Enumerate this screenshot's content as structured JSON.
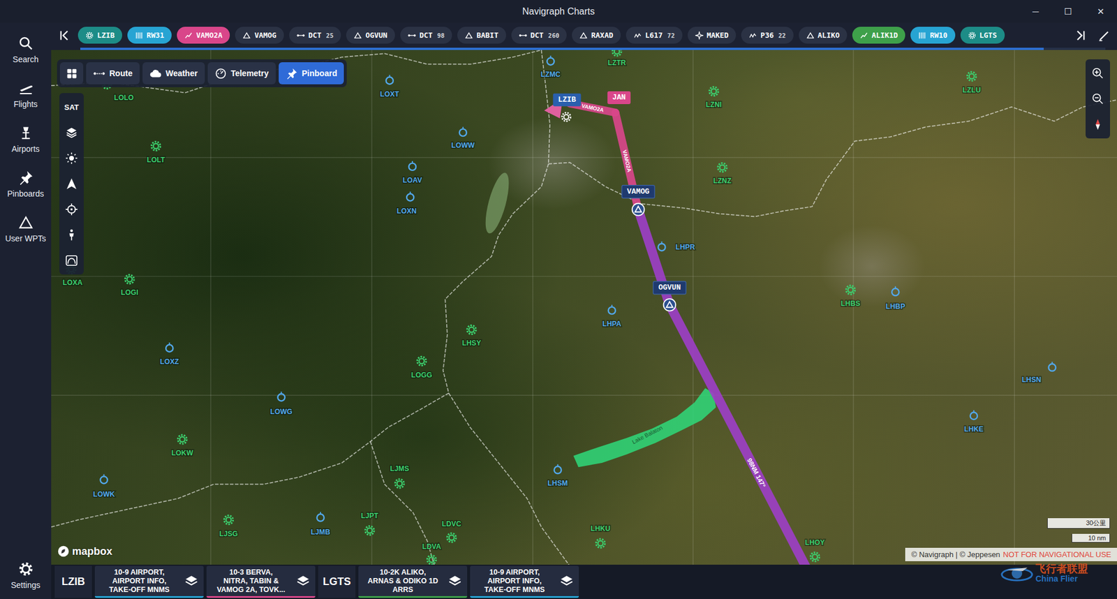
{
  "window": {
    "title": "Navigraph Charts",
    "controls": [
      "─",
      "☐",
      "✕"
    ]
  },
  "sidebar": {
    "items": [
      {
        "label": "Search",
        "selected": false
      },
      {
        "label": "Flights",
        "selected": false
      },
      {
        "label": "Airports",
        "selected": false
      },
      {
        "label": "Pinboards",
        "selected": false
      },
      {
        "label": "User WPTs",
        "selected": false
      }
    ],
    "settings": "Settings"
  },
  "route_strip": {
    "chips": [
      {
        "label": "LZIB",
        "kind": "airport",
        "color": "#1d8c87"
      },
      {
        "label": "RW31",
        "kind": "runway",
        "color": "#27a4d3"
      },
      {
        "label": "VAMO2A",
        "kind": "sid",
        "color": "#d9468a"
      },
      {
        "label": "VAMOG",
        "kind": "waypoint",
        "color": "#2b3244"
      },
      {
        "label": "DCT",
        "sub": "25",
        "kind": "dct",
        "color": "#2b3244"
      },
      {
        "label": "OGVUN",
        "kind": "waypoint",
        "color": "#2b3244"
      },
      {
        "label": "DCT",
        "sub": "98",
        "kind": "dct",
        "color": "#2b3244"
      },
      {
        "label": "BABIT",
        "kind": "waypoint",
        "color": "#2b3244"
      },
      {
        "label": "DCT",
        "sub": "260",
        "kind": "dct",
        "color": "#2b3244"
      },
      {
        "label": "RAXAD",
        "kind": "waypoint",
        "color": "#2b3244"
      },
      {
        "label": "L617",
        "sub": "72",
        "kind": "airway",
        "color": "#2b3244"
      },
      {
        "label": "MAKED",
        "kind": "fix",
        "color": "#2b3244"
      },
      {
        "label": "P36",
        "sub": "22",
        "kind": "airway",
        "color": "#2b3244"
      },
      {
        "label": "ALIKO",
        "kind": "waypoint",
        "color": "#2b3244"
      },
      {
        "label": "ALIK1D",
        "kind": "star",
        "color": "#3ea04a"
      },
      {
        "label": "RW10",
        "kind": "runway",
        "color": "#27a4d3"
      },
      {
        "label": "LGTS",
        "kind": "airport",
        "color": "#1d8c87"
      }
    ]
  },
  "map_toolbar": {
    "buttons": [
      {
        "label": "Route",
        "selected": false
      },
      {
        "label": "Weather",
        "selected": false
      },
      {
        "label": "Telemetry",
        "selected": false
      },
      {
        "label": "Pinboard",
        "selected": true
      }
    ]
  },
  "map_tools": {
    "label": "SAT"
  },
  "airports": [
    {
      "code": "LOLO",
      "kind": "gear",
      "color": "#3ccf6e"
    },
    {
      "code": "LZTR",
      "kind": "gear",
      "color": "#3ccf6e"
    },
    {
      "code": "LZMC",
      "kind": "ring",
      "color": "#52a8ec"
    },
    {
      "code": "LOXT",
      "kind": "ring",
      "color": "#52a8ec"
    },
    {
      "code": "LZNI",
      "kind": "gear",
      "color": "#3ccf6e"
    },
    {
      "code": "LZLU",
      "kind": "gear",
      "color": "#3ccf6e"
    },
    {
      "code": "LOWW",
      "kind": "ring",
      "color": "#52a8ec"
    },
    {
      "code": "LOLT",
      "kind": "gear",
      "color": "#3ccf6e"
    },
    {
      "code": "LOAV",
      "kind": "ring",
      "color": "#52a8ec"
    },
    {
      "code": "LZNZ",
      "kind": "gear",
      "color": "#3ccf6e"
    },
    {
      "code": "LOXN",
      "kind": "ring",
      "color": "#52a8ec"
    },
    {
      "code": "LHPR",
      "kind": "ring",
      "color": "#52a8ec"
    },
    {
      "code": "LOGI",
      "kind": "gear",
      "color": "#3ccf6e"
    },
    {
      "code": "LOXA",
      "kind": "gear",
      "color": "#3ccf6e"
    },
    {
      "code": "LHBS",
      "kind": "gear",
      "color": "#3ccf6e"
    },
    {
      "code": "LHBP",
      "kind": "ring",
      "color": "#52a8ec"
    },
    {
      "code": "LHPA",
      "kind": "ring",
      "color": "#52a8ec"
    },
    {
      "code": "LHSY",
      "kind": "gear",
      "color": "#3ccf6e"
    },
    {
      "code": "LOXZ",
      "kind": "ring",
      "color": "#52a8ec"
    },
    {
      "code": "LOGG",
      "kind": "gear",
      "color": "#3ccf6e"
    },
    {
      "code": "LHSN",
      "kind": "ring",
      "color": "#52a8ec"
    },
    {
      "code": "LOWG",
      "kind": "ring",
      "color": "#52a8ec"
    },
    {
      "code": "LHKE",
      "kind": "ring",
      "color": "#52a8ec"
    },
    {
      "code": "LOKW",
      "kind": "gear",
      "color": "#3ccf6e"
    },
    {
      "code": "LJMS",
      "kind": "gear",
      "color": "#3ccf6e"
    },
    {
      "code": "LHSM",
      "kind": "ring",
      "color": "#52a8ec"
    },
    {
      "code": "LOWK",
      "kind": "ring",
      "color": "#52a8ec"
    },
    {
      "code": "LJSG",
      "kind": "gear",
      "color": "#3ccf6e"
    },
    {
      "code": "LJMB",
      "kind": "ring",
      "color": "#52a8ec"
    },
    {
      "code": "LJPT",
      "kind": "gear",
      "color": "#3ccf6e"
    },
    {
      "code": "LDVC",
      "kind": "gear",
      "color": "#3ccf6e"
    },
    {
      "code": "LHKU",
      "kind": "gear",
      "color": "#3ccf6e"
    },
    {
      "code": "LHOY",
      "kind": "gear",
      "color": "#3ccf6e"
    },
    {
      "code": "LDVA",
      "kind": "gear",
      "color": "#3ccf6e"
    }
  ],
  "route_points": [
    {
      "name": "LZIB",
      "kind": "airport"
    },
    {
      "name": "JAN",
      "kind": "fix"
    },
    {
      "name": "VAMOG",
      "kind": "waypoint"
    },
    {
      "name": "OGVUN",
      "kind": "waypoint"
    }
  ],
  "route_segments": [
    {
      "label": "VAMO2A",
      "color": "#d9468a"
    },
    {
      "label": "VAMO2A",
      "color": "#d9468a"
    },
    {
      "label": "98NM 147°",
      "color": "#9c3fc4"
    }
  ],
  "lake": {
    "label": "Lake Balaton"
  },
  "scale": [
    "30公里",
    "10 nm"
  ],
  "mapbox": "mapbox",
  "attribution": {
    "credits": "© Navigraph | © Jeppesen",
    "warning": "NOT FOR NAVIGATIONAL USE"
  },
  "bottom_bar": {
    "groups": [
      {
        "airport": "LZIB",
        "charts": [
          {
            "lines": [
              "10-9 AIRPORT,",
              "AIRPORT INFO,",
              "TAKE-OFF MNMS"
            ],
            "color": "#27a4d3"
          },
          {
            "lines": [
              "10-3 BERVA,",
              "NITRA, TABIN &",
              "VAMOG 2A, TOVK..."
            ],
            "color": "#d9468a"
          }
        ]
      },
      {
        "airport": "LGTS",
        "charts": [
          {
            "lines": [
              "10-2K ALIKO,",
              "ARNAS & ODIKO 1D",
              "ARRS"
            ],
            "color": "#3ea04a"
          },
          {
            "lines": [
              "10-9 AIRPORT,",
              "AIRPORT INFO,",
              "TAKE-OFF MNMS"
            ],
            "color": "#27a4d3"
          }
        ]
      }
    ]
  },
  "watermark": {
    "chinese": "飞行者联盟",
    "english": "China Flier"
  }
}
